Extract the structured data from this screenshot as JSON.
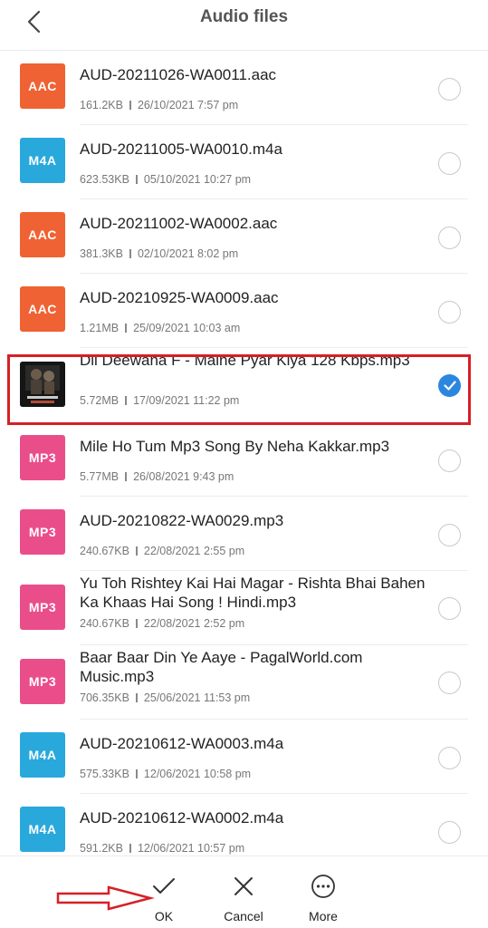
{
  "header": {
    "title": "Audio files"
  },
  "files": [
    {
      "type": "aac",
      "badge": "AAC",
      "name": "AUD-20211026-WA0011.aac",
      "size": "161.2KB",
      "date": "26/10/2021 7:57 pm",
      "selected": false
    },
    {
      "type": "m4a",
      "badge": "M4A",
      "name": "AUD-20211005-WA0010.m4a",
      "size": "623.53KB",
      "date": "05/10/2021 10:27 pm",
      "selected": false
    },
    {
      "type": "aac",
      "badge": "AAC",
      "name": "AUD-20211002-WA0002.aac",
      "size": "381.3KB",
      "date": "02/10/2021 8:02 pm",
      "selected": false
    },
    {
      "type": "aac",
      "badge": "AAC",
      "name": "AUD-20210925-WA0009.aac",
      "size": "1.21MB",
      "date": "25/09/2021 10:03 am",
      "selected": false
    },
    {
      "type": "img",
      "badge": "",
      "name": "Dil Deewana F - Maine Pyar Kiya 128 Kbps.mp3",
      "size": "5.72MB",
      "date": "17/09/2021 11:22 pm",
      "selected": true
    },
    {
      "type": "mp3",
      "badge": "MP3",
      "name": "Mile Ho Tum Mp3 Song By Neha Kakkar.mp3",
      "size": "5.77MB",
      "date": "26/08/2021 9:43 pm",
      "selected": false
    },
    {
      "type": "mp3",
      "badge": "MP3",
      "name": "AUD-20210822-WA0029.mp3",
      "size": "240.67KB",
      "date": "22/08/2021 2:55 pm",
      "selected": false
    },
    {
      "type": "mp3",
      "badge": "MP3",
      "name": "Yu Toh Rishtey Kai Hai Magar - Rishta Bhai Bahen Ka Khaas Hai Song ! Hindi.mp3",
      "size": "240.67KB",
      "date": "22/08/2021 2:52 pm",
      "selected": false
    },
    {
      "type": "mp3",
      "badge": "MP3",
      "name": "Baar Baar Din Ye Aaye  - PagalWorld.com Music.mp3",
      "size": "706.35KB",
      "date": "25/06/2021 11:53 pm",
      "selected": false
    },
    {
      "type": "m4a",
      "badge": "M4A",
      "name": "AUD-20210612-WA0003.m4a",
      "size": "575.33KB",
      "date": "12/06/2021 10:58 pm",
      "selected": false
    },
    {
      "type": "m4a",
      "badge": "M4A",
      "name": "AUD-20210612-WA0002.m4a",
      "size": "591.2KB",
      "date": "12/06/2021 10:57 pm",
      "selected": false
    }
  ],
  "actions": {
    "ok": "OK",
    "cancel": "Cancel",
    "more": "More"
  },
  "colors": {
    "aac": "#ef6233",
    "m4a": "#29a8dc",
    "mp3": "#ea4e8a",
    "check": "#2b86e0",
    "highlight": "#d71f26"
  }
}
